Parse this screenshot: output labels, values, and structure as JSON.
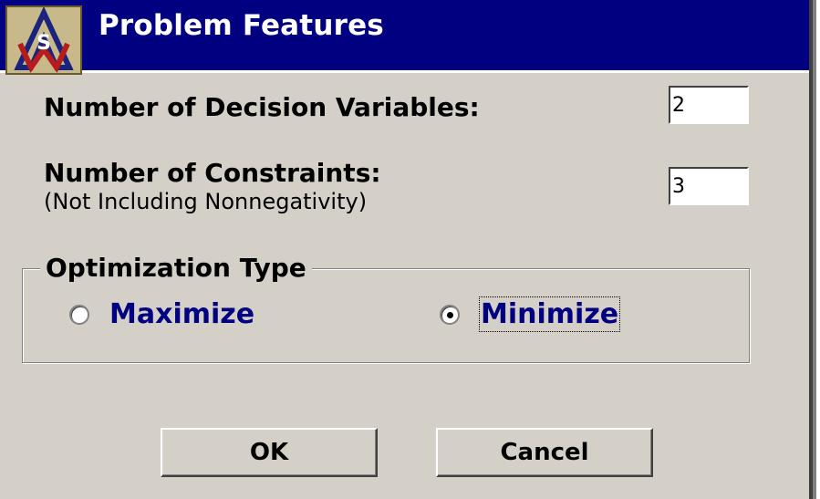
{
  "window": {
    "title": "Problem Features",
    "icon": "app-logo-icon"
  },
  "fields": {
    "decision_variables": {
      "label": "Number of Decision Variables:",
      "value": "2"
    },
    "constraints": {
      "label": "Number of Constraints:",
      "note": "(Not Including Nonnegativity)",
      "value": "3"
    }
  },
  "optimization": {
    "group_label": "Optimization Type",
    "options": [
      {
        "label": "Maximize",
        "selected": false
      },
      {
        "label": "Minimize",
        "selected": true
      }
    ]
  },
  "buttons": {
    "ok": "OK",
    "cancel": "Cancel"
  },
  "colors": {
    "title_bar": "#000080",
    "dialog_bg": "#d4d0c8",
    "option_text": "#000080"
  }
}
